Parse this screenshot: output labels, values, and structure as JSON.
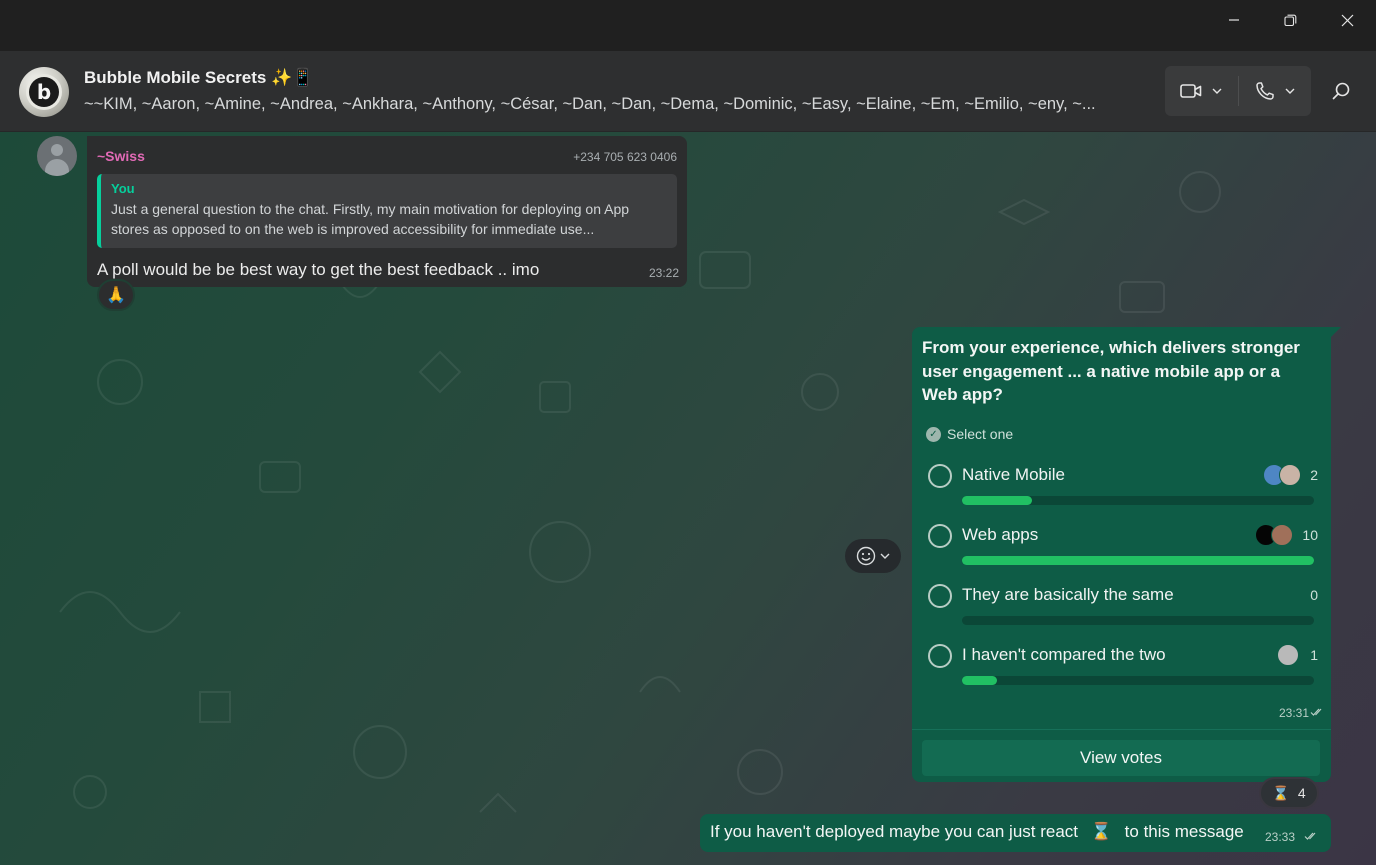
{
  "window": {
    "minimize_icon": "minimize-icon",
    "restore_icon": "restore-icon",
    "close_icon": "close-icon"
  },
  "header": {
    "group_name": "Bubble Mobile Secrets ✨📱",
    "members": "~~KIM, ~Aaron, ~Amine, ~Andrea, ~Ankhara, ~Anthony, ~César, ~Dan, ~Dan, ~Dema, ~Dominic, ~Easy, ~Elaine, ~Em, ~Emilio, ~eny, ~...",
    "avatar_letter": "b",
    "video_icon": "video-call-icon",
    "voice_icon": "voice-call-icon",
    "search_icon": "search-icon"
  },
  "incoming": {
    "sender_name": "~Swiss",
    "sender_phone": "+234 705 623 0406",
    "quote_author": "You",
    "quote_text": "Just a general question to the chat. Firstly, my main motivation for deploying on App stores as opposed to on the web is improved accessibility for immediate use...",
    "text": "A poll would be be best way to get the best feedback .. imo",
    "time": "23:22",
    "reaction": "🙏"
  },
  "poll": {
    "question": "From your experience, which delivers stronger user engagement ... a native mobile app or a Web app?",
    "select_label": "Select one",
    "options": [
      {
        "label": "Native Mobile",
        "count": "2",
        "fraction": 0.2
      },
      {
        "label": "Web apps",
        "count": "10",
        "fraction": 1.0
      },
      {
        "label": "They are basically the same",
        "count": "0",
        "fraction": 0.0
      },
      {
        "label": "I haven't compared the two",
        "count": "1",
        "fraction": 0.1
      }
    ],
    "time": "23:31",
    "view_votes": "View votes",
    "reaction_emoji": "⌛",
    "reaction_count": "4"
  },
  "outgoing": {
    "text_before": "If you haven't deployed maybe you can just react",
    "emoji": "⌛",
    "text_after": "to this message",
    "time": "23:33"
  },
  "colors": {
    "accent_green": "#21c063",
    "outgoing_bubble": "#0e5c46",
    "incoming_bubble": "#2c2d2e",
    "sender_name": "#e26ab6",
    "quote_bar": "#06cf9c"
  }
}
